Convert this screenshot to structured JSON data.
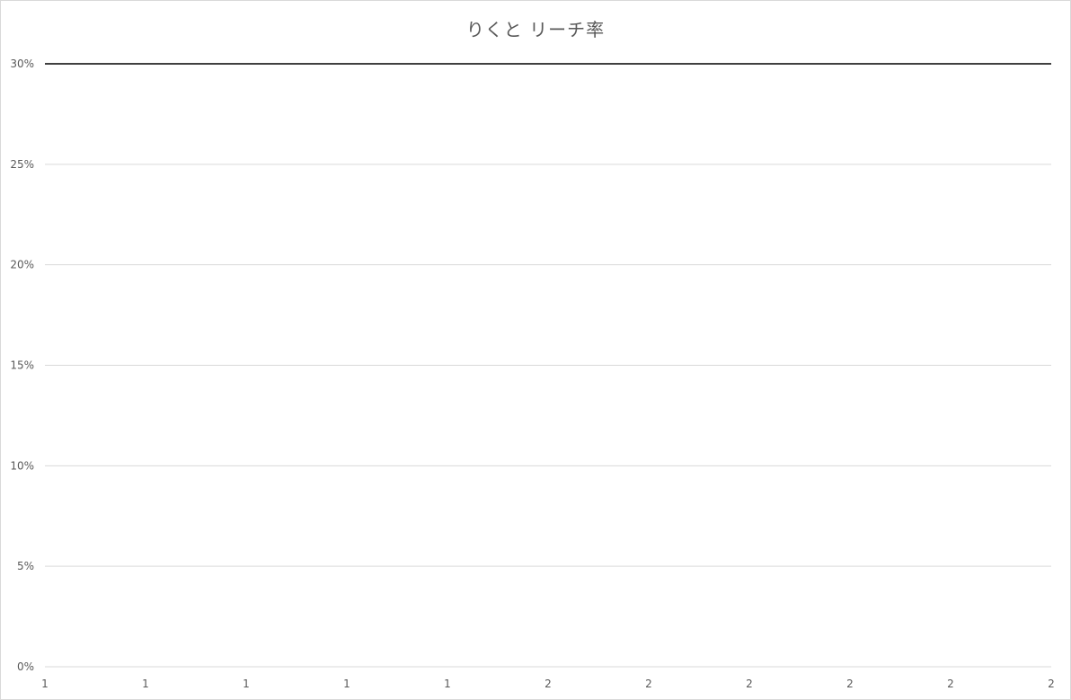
{
  "chart_data": {
    "type": "line",
    "title": "りくと リーチ率",
    "xlabel": "",
    "ylabel": "",
    "x": [
      "1",
      "1",
      "1",
      "1",
      "1",
      "2",
      "2",
      "2",
      "2",
      "2",
      "2"
    ],
    "ylim": [
      0,
      0.3
    ],
    "y_ticks": [
      "0%",
      "5%",
      "10%",
      "15%",
      "20%",
      "25%",
      "30%"
    ],
    "series": [
      {
        "values": [
          0.3,
          0.3,
          0.3,
          0.3,
          0.3,
          0.3,
          0.3,
          0.3,
          0.3,
          0.3,
          0.3
        ],
        "color": "#404040"
      }
    ],
    "grid": true,
    "legend": "none",
    "gridline_color": "#d9d9d9"
  }
}
